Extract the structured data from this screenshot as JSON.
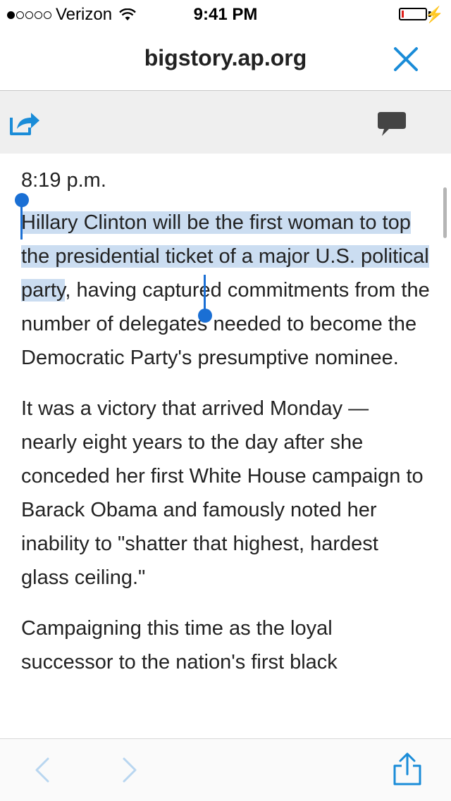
{
  "status_bar": {
    "carrier": "Verizon",
    "signal_bars": 1,
    "time": "9:41 PM",
    "battery_level": 0.1,
    "battery_color": "#e0201b"
  },
  "url_bar": {
    "domain": "bigstory.ap.org",
    "close_icon": "close-icon"
  },
  "toolbar": {
    "share_icon": "share-icon",
    "comment_icon": "comment-icon"
  },
  "article": {
    "timestamp": "8:19 p.m.",
    "p1_selected": "Hillary Clinton will be the first woman to top the presidential ticket of a major U.S. political party",
    "p1_rest": ", having captured commitments from the number of delegates needed to become the Democratic Party's presumptive nominee.",
    "p2": "It was a victory that arrived Monday — nearly eight years to the day after she conceded her first White House campaign to Barack Obama and famously noted her inability to \"shatter that highest, hardest glass ceiling.\"",
    "p3": "Campaigning this time as the loyal successor to the nation's first black"
  },
  "bottom_bar": {
    "back_icon": "chevron-left-icon",
    "forward_icon": "chevron-right-icon",
    "share_icon": "share-icon"
  },
  "colors": {
    "accent": "#1a8cd8",
    "selection": "#5c96d2",
    "caret": "#1a6fd4"
  }
}
